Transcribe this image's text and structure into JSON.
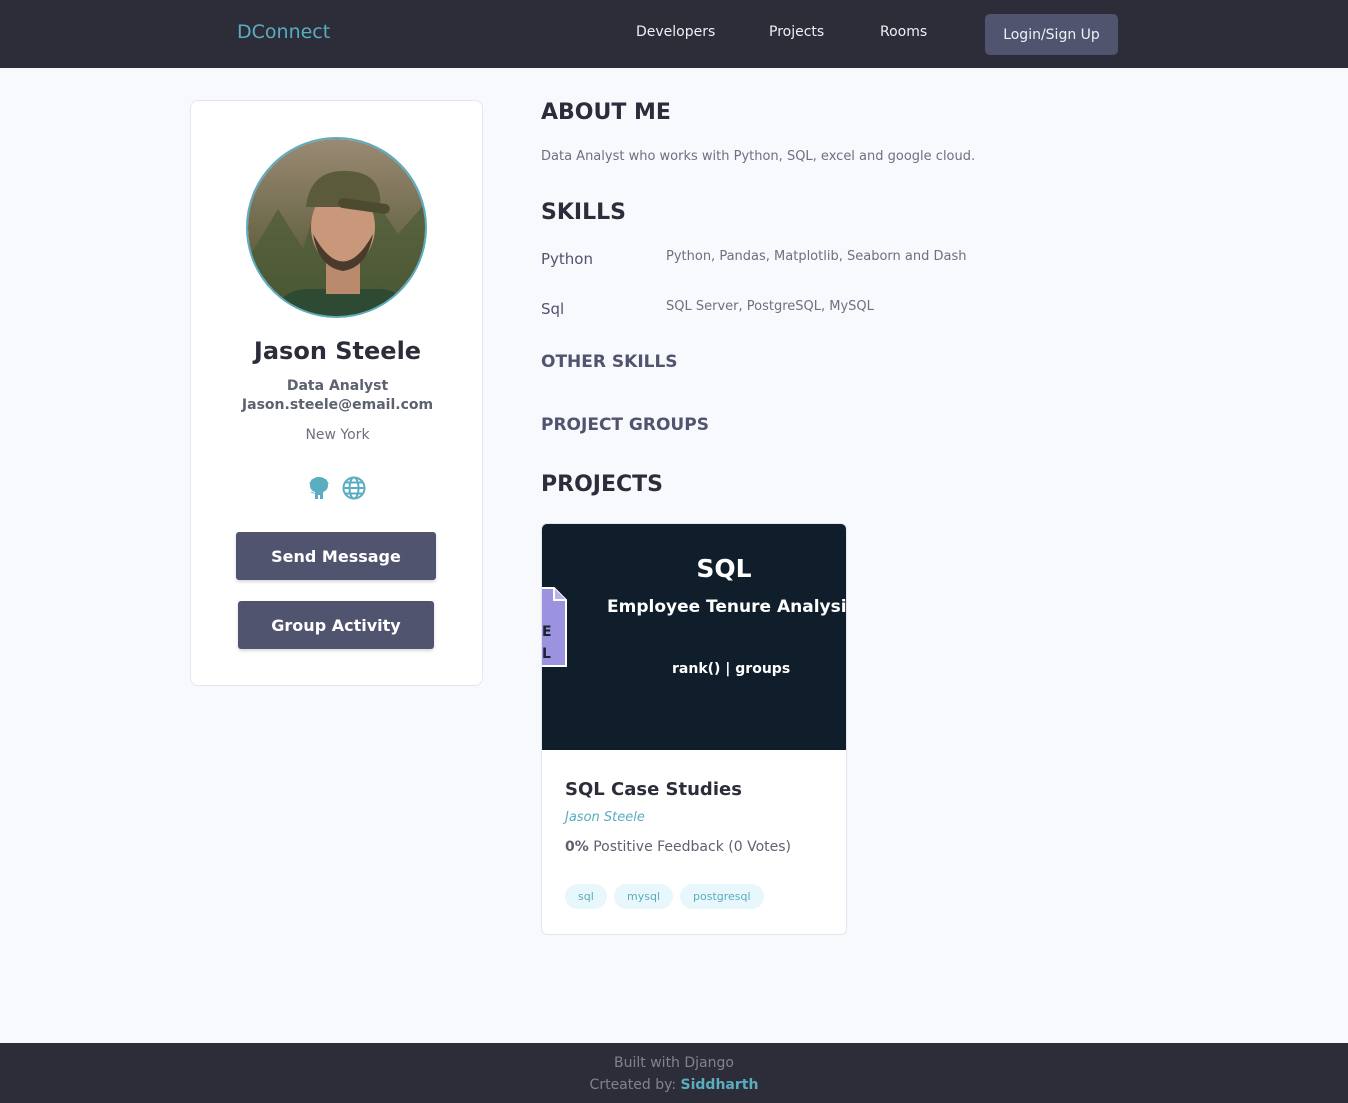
{
  "header": {
    "logo": "DConnect",
    "nav": [
      "Developers",
      "Projects",
      "Rooms"
    ],
    "login_label": "Login/Sign Up"
  },
  "profile": {
    "name": "Jason Steele",
    "role": "Data Analyst",
    "email": "Jason.steele@email.com",
    "location": "New York",
    "social_icons": [
      "github-icon",
      "globe-icon"
    ],
    "send_message_label": "Send Message",
    "group_activity_label": "Group Activity"
  },
  "about": {
    "heading": "ABOUT ME",
    "text": "Data Analyst who works with Python, SQL, excel and google cloud."
  },
  "skills": {
    "heading": "SKILLS",
    "items": [
      {
        "name": "Python",
        "description": "Python, Pandas, Matplotlib, Seaborn and Dash"
      },
      {
        "name": "Sql",
        "description": "SQL Server, PostgreSQL, MySQL"
      }
    ],
    "other_heading": "OTHER SKILLS",
    "groups_heading": "PROJECT GROUPS"
  },
  "projects": {
    "heading": "PROJECTS",
    "items": [
      {
        "thumbnail": {
          "title": "SQL",
          "subtitle": "Employee Tenure Analysis",
          "tags_text": "rank()  |  groups"
        },
        "title": "SQL Case Studies",
        "author": "Jason Steele",
        "feedback_percent": "0%",
        "feedback_text": "Postitive Feedback (0 Votes)",
        "tags": [
          "sql",
          "mysql",
          "postgresql"
        ]
      }
    ]
  },
  "footer": {
    "line1": "Built with Django",
    "created_prefix": "Crteated by:",
    "author": "Siddharth"
  },
  "colors": {
    "header_bg": "#2d2d39",
    "accent": "#5aacc0",
    "button_bg": "#51546e",
    "page_bg": "#f7f9fd"
  }
}
